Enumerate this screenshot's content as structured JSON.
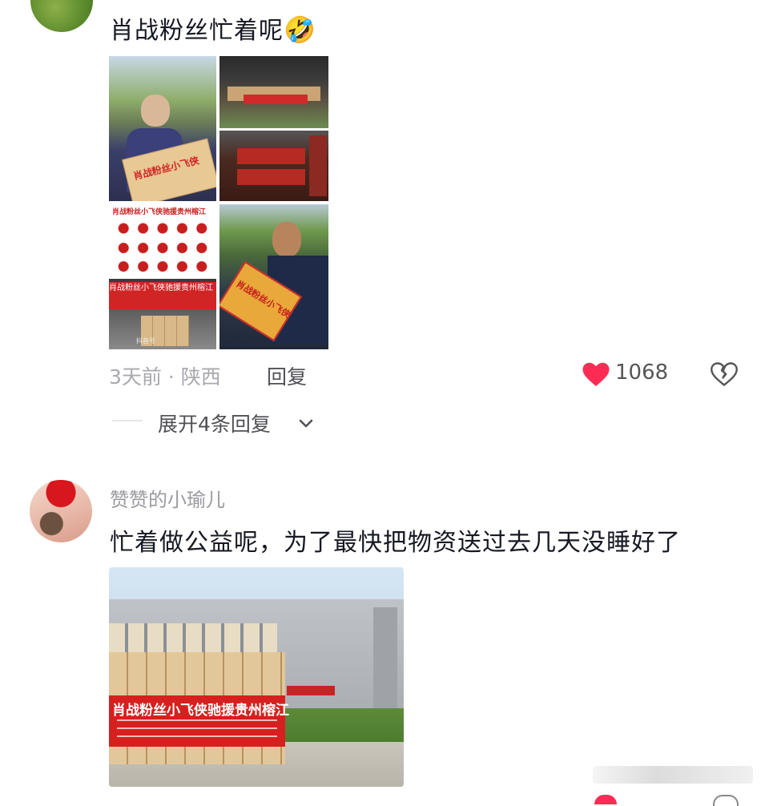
{
  "comment1": {
    "text": "肖战粉丝忙着呢",
    "emoji": "🤣",
    "image_grid": {
      "banner_top": "肖战粉丝小飞侠驰援贵州榕江",
      "box_label": "肖战粉丝小飞侠",
      "banner_bottom": "肖战粉丝小飞侠驰援贵州榕江",
      "watermark": "抖音号"
    },
    "meta": "3天前 · 陕西",
    "reply_label": "回复",
    "like_count": "1068",
    "icons": [
      "heart-icon",
      "dislike-icon"
    ]
  },
  "expand": {
    "label": "展开4条回复",
    "icon": "chevron-down-icon"
  },
  "comment2": {
    "username": "赞赞的小瑜儿",
    "text": "忙着做公益呢，为了最快把物资送过去几天没睡好了",
    "image": {
      "banner": "肖战粉丝小飞侠驰援贵州榕江"
    }
  },
  "colors": {
    "like": "#fe2c55",
    "meta": "#a9a9ae",
    "text": "#161823"
  }
}
